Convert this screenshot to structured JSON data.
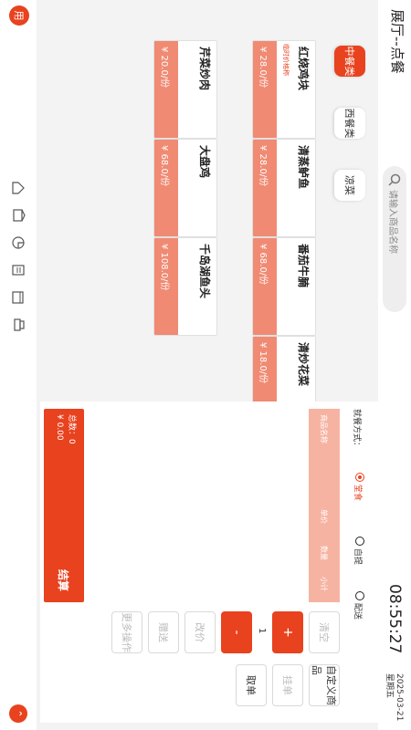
{
  "header": {
    "title": "展厅--点餐",
    "time": "08:55:27",
    "date": "2025-03-21",
    "weekday": "星期五",
    "search_placeholder": "请输入商品名称",
    "avatar_text": "用"
  },
  "categories": [
    {
      "label": "中餐类",
      "active": true
    },
    {
      "label": "西餐类",
      "active": false
    },
    {
      "label": "凉菜",
      "active": false
    }
  ],
  "dishes": [
    {
      "name": "红烧鸡块",
      "price": "¥ 28.0/份",
      "tag": "临时价格称"
    },
    {
      "name": "清蒸鲈鱼",
      "price": "¥ 28.0/份",
      "tag": ""
    },
    {
      "name": "番茄牛腩",
      "price": "¥ 68.0/份",
      "tag": ""
    },
    {
      "name": "清炒花菜",
      "price": "¥ 18.0/份",
      "tag": ""
    },
    {
      "name": "芹菜炒肉",
      "price": "¥ 20.0/份",
      "tag": ""
    },
    {
      "name": "大盘鸡",
      "price": "¥ 68.0/份",
      "tag": ""
    },
    {
      "name": "千岛湖鱼头",
      "price": "¥ 108.0/份",
      "tag": ""
    }
  ],
  "dining": {
    "label": "就餐方式：",
    "options": [
      {
        "label": "堂食",
        "selected": true
      },
      {
        "label": "自提",
        "selected": false
      },
      {
        "label": "配送",
        "selected": false
      }
    ]
  },
  "order_table": {
    "headers": [
      "商品名称",
      "单价",
      "数量",
      "小计"
    ]
  },
  "actions": {
    "clear": "清空",
    "plus": "+",
    "quantity": "1",
    "minus": "-",
    "change_price": "改价",
    "gift": "赠送",
    "more": "更多操作",
    "custom": "自定义商品",
    "hold": "挂单",
    "retrieve": "取单"
  },
  "summary": {
    "count_label": "总数：0",
    "total": "¥ 0.00",
    "checkout": "结算"
  },
  "colors": {
    "accent": "#e8421f",
    "price_bg": "#f08a73",
    "header_bg": "#f7b3a2"
  }
}
